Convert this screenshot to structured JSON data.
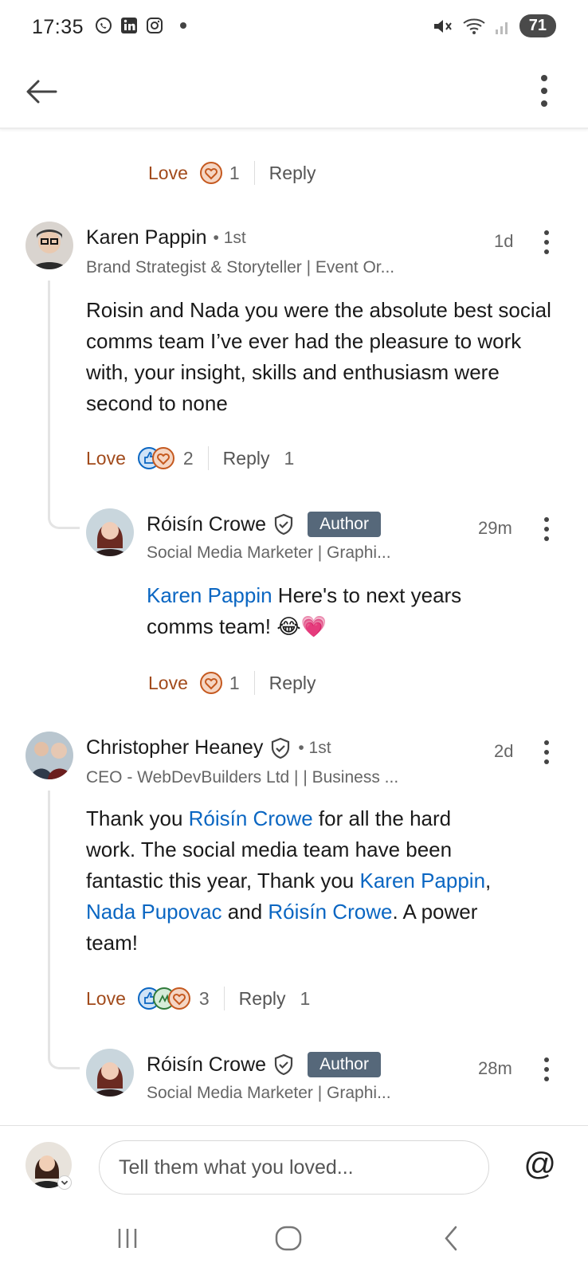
{
  "status_bar": {
    "time": "17:35",
    "left_icons": [
      "whatsapp-icon",
      "linkedin-icon",
      "instagram-icon"
    ],
    "battery": "71"
  },
  "app_bar": {
    "back": "back-arrow-icon",
    "more": "overflow-menu-icon"
  },
  "comments": [
    {
      "actions": {
        "love": "Love",
        "reactions": "1",
        "reply": "Reply"
      }
    },
    {
      "name": "Karen Pappin",
      "degree": "• 1st",
      "headline": "Brand Strategist & Storyteller | Event Or...",
      "time": "1d",
      "text": "Roisin and Nada you were the absolute best social comms team I’ve ever had the pleasure to work with,  your insight, skills and enthusiasm were second to none",
      "actions": {
        "love": "Love",
        "reactions": "2",
        "reply": "Reply",
        "reply_count": "1"
      },
      "reply": {
        "name": "Róisín Crowe",
        "badge": "Author",
        "headline": "Social Media Marketer | Graphi...",
        "time": "29m",
        "mention": "Karen Pappin",
        "text_line1": " Here's to next years",
        "text_line2": "comms team! 😂💗",
        "actions": {
          "love": "Love",
          "reactions": "1",
          "reply": "Reply"
        }
      }
    },
    {
      "name": "Christopher Heaney",
      "degree": "• 1st",
      "headline": "CEO - WebDevBuilders Ltd | | Business ...",
      "time": "2d",
      "text_parts": {
        "p1": "Thank you ",
        "m1": "Róisín Crowe",
        "p2": " for all the hard",
        "l2": "work. The social media team have been",
        "l3a": "fantastic this year, Thank you ",
        "m2": "Karen Pappin",
        "l3b": ",",
        "m3": "Nada Pupovac",
        "p4": " and ",
        "m4": "Róisín Crowe",
        "p5": ". A power",
        "l5": "team!"
      },
      "actions": {
        "love": "Love",
        "reactions": "3",
        "reply": "Reply",
        "reply_count": "1"
      },
      "reply": {
        "name": "Róisín Crowe",
        "badge": "Author",
        "headline": "Social Media Marketer | Graphi...",
        "time": "28m"
      }
    }
  ],
  "composer": {
    "placeholder": "Tell them what you loved...",
    "at": "@"
  },
  "colors": {
    "love": "#a14a1b",
    "mention": "#0a66c2",
    "author_badge": "#56687a"
  }
}
